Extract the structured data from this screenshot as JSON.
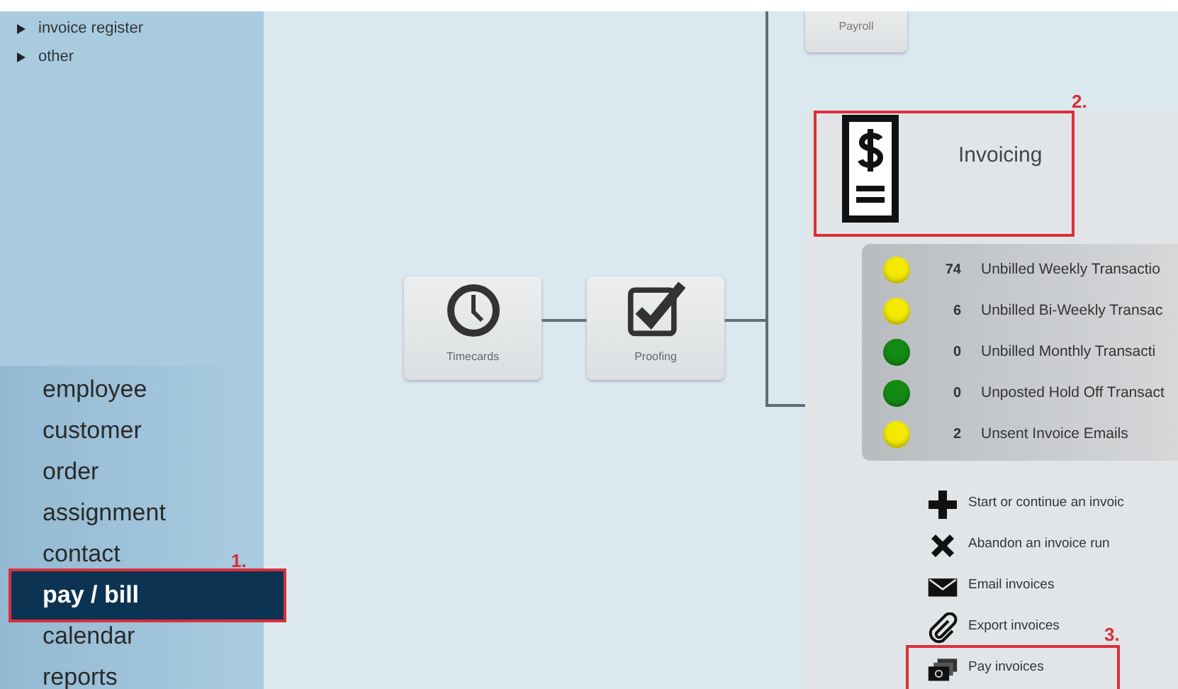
{
  "sidebar": {
    "tree_items": [
      {
        "label": "invoice register",
        "expanded": false
      },
      {
        "label": "other",
        "expanded": false
      }
    ],
    "nav_items": [
      {
        "label": "employee",
        "selected": false
      },
      {
        "label": "customer",
        "selected": false
      },
      {
        "label": "order",
        "selected": false
      },
      {
        "label": "assignment",
        "selected": false
      },
      {
        "label": "contact",
        "selected": false
      },
      {
        "label": "pay / bill",
        "selected": true,
        "annotation": "1."
      },
      {
        "label": "calendar",
        "selected": false
      },
      {
        "label": "reports",
        "selected": false
      }
    ]
  },
  "workflow": {
    "payroll": {
      "label": "Payroll"
    },
    "steps": [
      {
        "label": "Timecards",
        "kind": "clock"
      },
      {
        "label": "Proofing",
        "kind": "check"
      }
    ]
  },
  "invoicing": {
    "title": "Invoicing",
    "annotation": "2.",
    "status_items": [
      {
        "count": "74",
        "label": "Unbilled Weekly Transactio",
        "color": "#f3ea00"
      },
      {
        "count": "6",
        "label": "Unbilled Bi-Weekly Transac",
        "color": "#f3ea00"
      },
      {
        "count": "0",
        "label": "Unbilled Monthly Transacti",
        "color": "#138a13"
      },
      {
        "count": "0",
        "label": "Unposted Hold Off Transact",
        "color": "#138a13"
      },
      {
        "count": "2",
        "label": "Unsent Invoice Emails",
        "color": "#f3ea00"
      }
    ],
    "actions": [
      {
        "label": "Start or continue an invoic",
        "kind": "plus"
      },
      {
        "label": "Abandon an invoice run",
        "kind": "cross"
      },
      {
        "label": "Email invoices",
        "kind": "mail"
      },
      {
        "label": "Export invoices",
        "kind": "clip"
      },
      {
        "label": "Pay invoices",
        "kind": "money",
        "annotation": "3."
      }
    ]
  }
}
